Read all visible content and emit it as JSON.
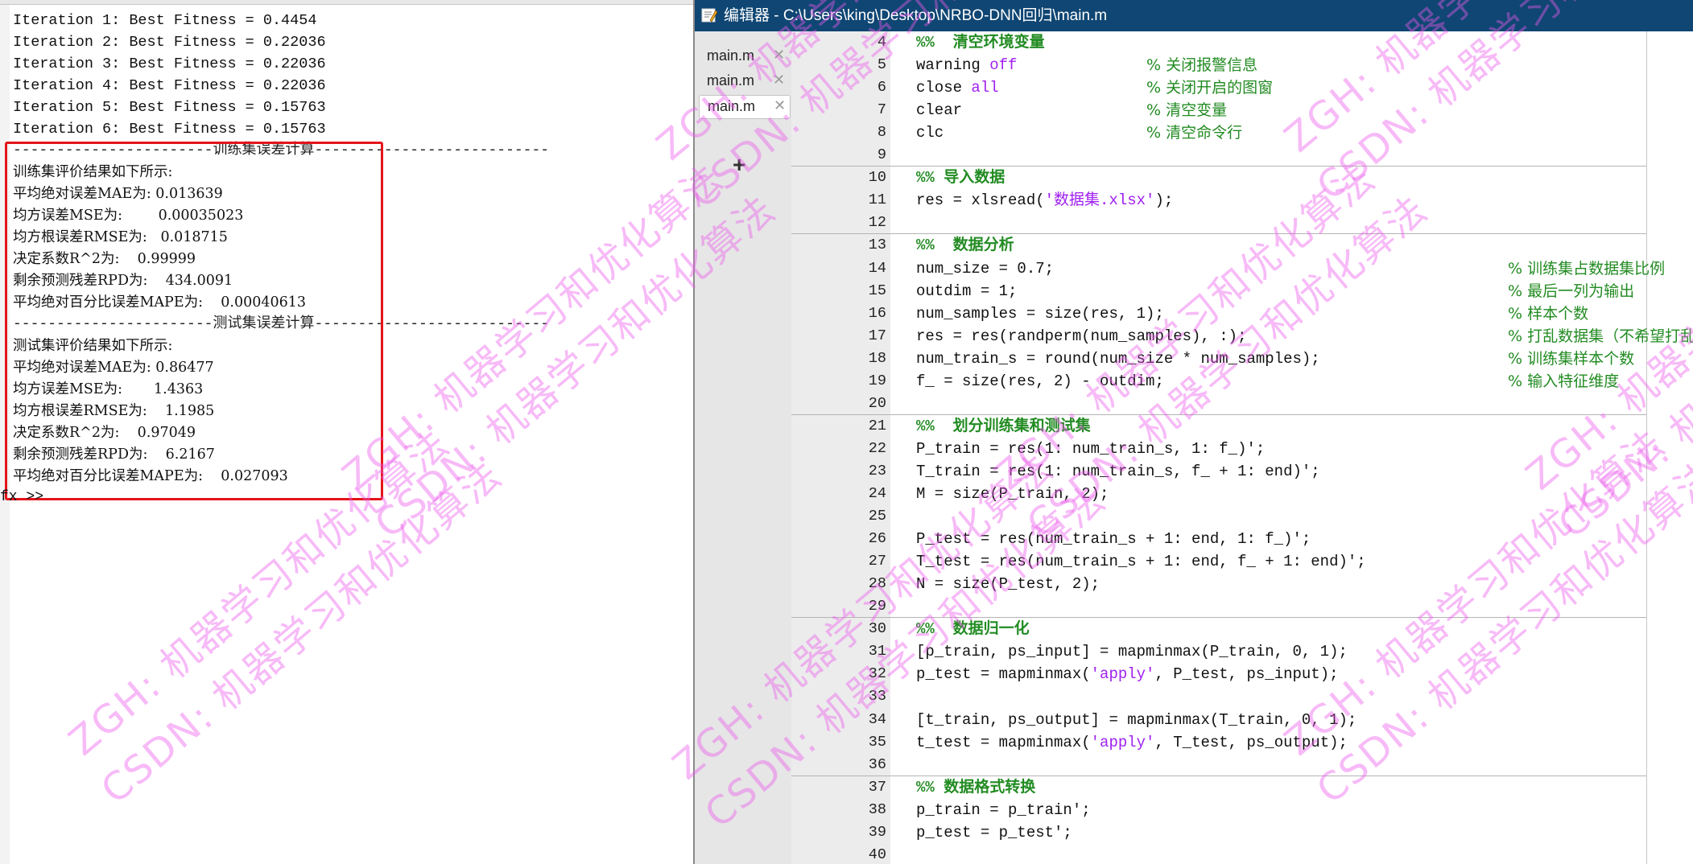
{
  "command_window": {
    "lines": [
      {
        "text": "Iteration 1: Best Fitness = 0.4454",
        "style": "mono"
      },
      {
        "text": "Iteration 2: Best Fitness = 0.22036",
        "style": "mono"
      },
      {
        "text": "Iteration 3: Best Fitness = 0.22036",
        "style": "mono"
      },
      {
        "text": "Iteration 4: Best Fitness = 0.22036",
        "style": "mono"
      },
      {
        "text": "Iteration 5: Best Fitness = 0.15763",
        "style": "mono"
      },
      {
        "text": "Iteration 6: Best Fitness = 0.15763",
        "style": "mono"
      },
      {
        "text": "-----------------------训练集误差计算---------------------------",
        "style": "sep"
      },
      {
        "text": "训练集评价结果如下所示:",
        "style": "cn"
      },
      {
        "text": "平均绝对误差MAE为: 0.013639",
        "style": "cn"
      },
      {
        "text": "均方误差MSE为:        0.00035023",
        "style": "cn"
      },
      {
        "text": "均方根误差RMSE为:   0.018715",
        "style": "cn"
      },
      {
        "text": "决定系数R^2为:    0.99999",
        "style": "cn"
      },
      {
        "text": "剩余预测残差RPD为:    434.0091",
        "style": "cn"
      },
      {
        "text": "平均绝对百分比误差MAPE为:    0.00040613",
        "style": "cn"
      },
      {
        "text": "-----------------------测试集误差计算---------------------------",
        "style": "sep"
      },
      {
        "text": "测试集评价结果如下所示:",
        "style": "cn"
      },
      {
        "text": "平均绝对误差MAE为: 0.86477",
        "style": "cn"
      },
      {
        "text": "均方误差MSE为:       1.4363",
        "style": "cn"
      },
      {
        "text": "均方根误差RMSE为:    1.1985",
        "style": "cn"
      },
      {
        "text": "决定系数R^2为:    0.97049",
        "style": "cn"
      },
      {
        "text": "剩余预测残差RPD为:    6.2167",
        "style": "cn"
      },
      {
        "text": "平均绝对百分比误差MAPE为:    0.027093",
        "style": "cn"
      }
    ],
    "prompt": "fx >>"
  },
  "editor": {
    "title": "编辑器 - C:\\Users\\king\\Desktop\\NRBO-DNN回归\\main.m",
    "tabs": [
      {
        "label": "main.m",
        "close": "✕",
        "active": false
      },
      {
        "label": "main.m",
        "close": "✕",
        "active": false
      },
      {
        "label": "main.m",
        "close": "✕",
        "active": true
      }
    ],
    "add_tab": "+",
    "lines": [
      {
        "n": "4",
        "fold": "",
        "cell": true,
        "code": "%%  清空环境变量",
        "comment": ""
      },
      {
        "n": "5",
        "fold": "",
        "cell": false,
        "code": "warning off",
        "comment": "% 关闭报警信息",
        "kw": "off"
      },
      {
        "n": "6",
        "fold": "",
        "cell": false,
        "code": "close all",
        "comment": "% 关闭开启的图窗",
        "kw": "all"
      },
      {
        "n": "7",
        "fold": "",
        "cell": false,
        "code": "clear",
        "comment": "% 清空变量"
      },
      {
        "n": "8",
        "fold": "",
        "cell": false,
        "code": "clc",
        "comment": "% 清空命令行"
      },
      {
        "n": "9",
        "fold": "",
        "cell": false,
        "code": "",
        "comment": ""
      },
      {
        "n": "10",
        "fold": "",
        "cell": true,
        "code": "%% 导入数据",
        "comment": ""
      },
      {
        "n": "11",
        "fold": "",
        "cell": false,
        "code": "res = xlsread('数据集.xlsx');",
        "comment": ""
      },
      {
        "n": "12",
        "fold": "",
        "cell": false,
        "code": "",
        "comment": ""
      },
      {
        "n": "13",
        "fold": "",
        "cell": true,
        "code": "%%  数据分析",
        "comment": ""
      },
      {
        "n": "14",
        "fold": "",
        "cell": false,
        "code": "num_size = 0.7;",
        "comment": "% 训练集占数据集比例"
      },
      {
        "n": "15",
        "fold": "",
        "cell": false,
        "code": "outdim = 1;",
        "comment": "% 最后一列为输出"
      },
      {
        "n": "16",
        "fold": "",
        "cell": false,
        "code": "num_samples = size(res, 1);",
        "comment": "% 样本个数"
      },
      {
        "n": "17",
        "fold": "",
        "cell": false,
        "code": "res = res(randperm(num_samples), :);",
        "comment": "% 打乱数据集（不希望打乱时，注释该行）"
      },
      {
        "n": "18",
        "fold": "",
        "cell": false,
        "code": "num_train_s = round(num_size * num_samples);",
        "comment": "% 训练集样本个数"
      },
      {
        "n": "19",
        "fold": "",
        "cell": false,
        "code": "f_ = size(res, 2) - outdim;",
        "comment": "% 输入特征维度"
      },
      {
        "n": "20",
        "fold": "",
        "cell": false,
        "code": "",
        "comment": ""
      },
      {
        "n": "21",
        "fold": "",
        "cell": true,
        "code": "%%  划分训练集和测试集",
        "comment": ""
      },
      {
        "n": "22",
        "fold": "",
        "cell": false,
        "code": "P_train = res(1: num_train_s, 1: f_)';",
        "comment": ""
      },
      {
        "n": "23",
        "fold": "",
        "cell": false,
        "code": "T_train = res(1: num_train_s, f_ + 1: end)';",
        "comment": ""
      },
      {
        "n": "24",
        "fold": "",
        "cell": false,
        "code": "M = size(P_train, 2);",
        "comment": ""
      },
      {
        "n": "25",
        "fold": "",
        "cell": false,
        "code": "",
        "comment": ""
      },
      {
        "n": "26",
        "fold": "",
        "cell": false,
        "code": "P_test = res(num_train_s + 1: end, 1: f_)';",
        "comment": ""
      },
      {
        "n": "27",
        "fold": "",
        "cell": false,
        "code": "T_test = res(num_train_s + 1: end, f_ + 1: end)';",
        "comment": ""
      },
      {
        "n": "28",
        "fold": "",
        "cell": false,
        "code": "N = size(P_test, 2);",
        "comment": ""
      },
      {
        "n": "29",
        "fold": "",
        "cell": false,
        "code": "",
        "comment": ""
      },
      {
        "n": "30",
        "fold": "",
        "cell": true,
        "code": "%%  数据归一化",
        "comment": ""
      },
      {
        "n": "31",
        "fold": "",
        "cell": false,
        "code": "[p_train, ps_input] = mapminmax(P_train, 0, 1);",
        "comment": ""
      },
      {
        "n": "32",
        "fold": "",
        "cell": false,
        "code": "p_test = mapminmax('apply', P_test, ps_input);",
        "comment": ""
      },
      {
        "n": "33",
        "fold": "",
        "cell": false,
        "code": "",
        "comment": ""
      },
      {
        "n": "34",
        "fold": "",
        "cell": false,
        "code": "[t_train, ps_output] = mapminmax(T_train, 0, 1);",
        "comment": ""
      },
      {
        "n": "35",
        "fold": "",
        "cell": false,
        "code": "t_test = mapminmax('apply', T_test, ps_output);",
        "comment": ""
      },
      {
        "n": "36",
        "fold": "",
        "cell": false,
        "code": "",
        "comment": ""
      },
      {
        "n": "37",
        "fold": "",
        "cell": true,
        "code": "%% 数据格式转换",
        "comment": ""
      },
      {
        "n": "38",
        "fold": "",
        "cell": false,
        "code": "p_train = p_train';",
        "comment": ""
      },
      {
        "n": "39",
        "fold": "",
        "cell": false,
        "code": "p_test = p_test';",
        "comment": ""
      },
      {
        "n": "40",
        "fold": "",
        "cell": false,
        "code": "",
        "comment": ""
      }
    ]
  },
  "watermark": {
    "texts": [
      "ZGH: 机器学习和优化算法",
      "CSDN: 机器学习和优化算法"
    ],
    "color": "#ec5aeb"
  },
  "colors": {
    "title_bar": "#0f4673",
    "comment": "#228b22",
    "string": "#a020f0",
    "highlight_box": "#e5141a"
  }
}
